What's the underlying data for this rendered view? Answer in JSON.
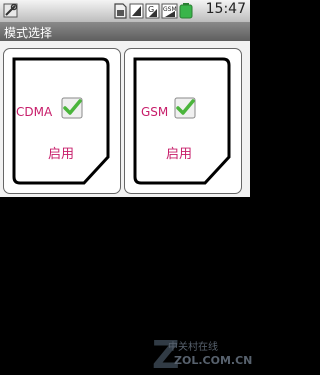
{
  "status_bar": {
    "time": "15:47",
    "icons": [
      "settings-icon",
      "sim-card-icon",
      "sim-signal-icon",
      "g-signal-icon",
      "gsm-signal-icon",
      "battery-icon"
    ]
  },
  "title_bar": {
    "title": "模式选择"
  },
  "cards": [
    {
      "mode": "CDMA",
      "checked": true,
      "button_label": "启用"
    },
    {
      "mode": "GSM",
      "checked": true,
      "button_label": "启用"
    }
  ],
  "watermark": {
    "brand_cn": "中关村在线",
    "brand_en": "ZOL.COM.CN",
    "logo_letter": "Z"
  },
  "colors": {
    "accent": "#c71d6a",
    "check": "#4bb53c",
    "titlebar": "#6f6f6f",
    "battery": "#39b54a"
  }
}
